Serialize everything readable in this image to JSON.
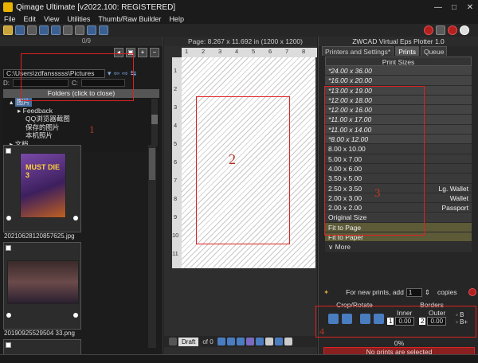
{
  "window": {
    "title": "Qimage Ultimate [v2022.100: REGISTERED]",
    "controls": [
      "—",
      "□",
      "✕"
    ]
  },
  "menu": [
    "File",
    "Edit",
    "View",
    "Utilities",
    "Thumb/Raw Builder",
    "Help"
  ],
  "left": {
    "counter": "0/9",
    "path": "C:\\Users\\zdfansssss\\Pictures",
    "d_label": "D:",
    "c_label": "C:",
    "folders_header": "Folders (click to close)",
    "tree": [
      {
        "label": "图片",
        "selected": true
      },
      {
        "label": "Feedback",
        "selected": false
      },
      {
        "label": "QQ浏览器截图",
        "selected": false
      },
      {
        "label": "保存的图片",
        "selected": false
      },
      {
        "label": "本机照片",
        "selected": false
      },
      {
        "label": "文档",
        "selected": false
      }
    ],
    "annotation": "1",
    "thumbnails": [
      {
        "filename": "20210628120857625.jpg",
        "poster_text": "MUST DIE 3"
      },
      {
        "filename": "20190925529504 33.png"
      }
    ]
  },
  "center": {
    "page_info": "Page: 8.267 x 11.692 in  (1200 x 1200)",
    "ruler_h": [
      "1",
      "2",
      "3",
      "4",
      "5",
      "6",
      "7",
      "8"
    ],
    "ruler_v": [
      "1",
      "2",
      "3",
      "4",
      "5",
      "6",
      "7",
      "8",
      "9",
      "10",
      "11"
    ],
    "annotation": "2",
    "draft_label": "Draft",
    "of_label": "of 0"
  },
  "right": {
    "title": "ZWCAD Virtual Eps Plotter 1.0",
    "tabs": [
      "Printers and Settings*",
      "Prints",
      "Queue"
    ],
    "print_sizes_header": "Print Sizes",
    "sizes": [
      {
        "label": "*24.00 x 36.00",
        "note": "",
        "style": "em"
      },
      {
        "label": "*16.00 x 20.00",
        "note": "",
        "style": "em"
      },
      {
        "label": "*13.00 x 19.00",
        "note": "",
        "style": "em"
      },
      {
        "label": "*12.00 x 18.00",
        "note": "",
        "style": "em"
      },
      {
        "label": "*12.00 x 16.00",
        "note": "",
        "style": "em"
      },
      {
        "label": "*11.00 x 17.00",
        "note": "",
        "style": "em"
      },
      {
        "label": "*11.00 x 14.00",
        "note": "",
        "style": "em"
      },
      {
        "label": "*8.00 x 12.00",
        "note": "",
        "style": "em"
      },
      {
        "label": "8.00 x 10.00",
        "note": "",
        "style": ""
      },
      {
        "label": "5.00 x 7.00",
        "note": "",
        "style": ""
      },
      {
        "label": "4.00 x 6.00",
        "note": "",
        "style": ""
      },
      {
        "label": "3.50 x 5.00",
        "note": "",
        "style": ""
      },
      {
        "label": "2.50 x 3.50",
        "note": "Lg. Wallet",
        "style": ""
      },
      {
        "label": "2.00 x 3.00",
        "note": "Wallet",
        "style": ""
      },
      {
        "label": "2.00 x 2.00",
        "note": "Passport",
        "style": ""
      },
      {
        "label": "Original Size",
        "note": "",
        "style": ""
      },
      {
        "label": "Fit to Page",
        "note": "",
        "style": "hl"
      },
      {
        "label": "Fit to Paper",
        "note": "",
        "style": "hl"
      },
      {
        "label": "∨ More",
        "note": "",
        "style": "more"
      }
    ],
    "annotation": "3",
    "copies_text": "For new prints, add",
    "copies_value": "1",
    "copies_label": "copies",
    "crop_rotate_label": "Crop/Rotate",
    "borders_label": "Borders",
    "inner_label": "Inner",
    "outer_label": "Outer",
    "inner_value": "0.00",
    "outer_value": "0.00",
    "inner_count": "1",
    "outer_count": "2",
    "b_label": "B",
    "bplus_label": "B+",
    "border_annotation": "4",
    "progress": "0%",
    "status": "No prints are selected"
  }
}
